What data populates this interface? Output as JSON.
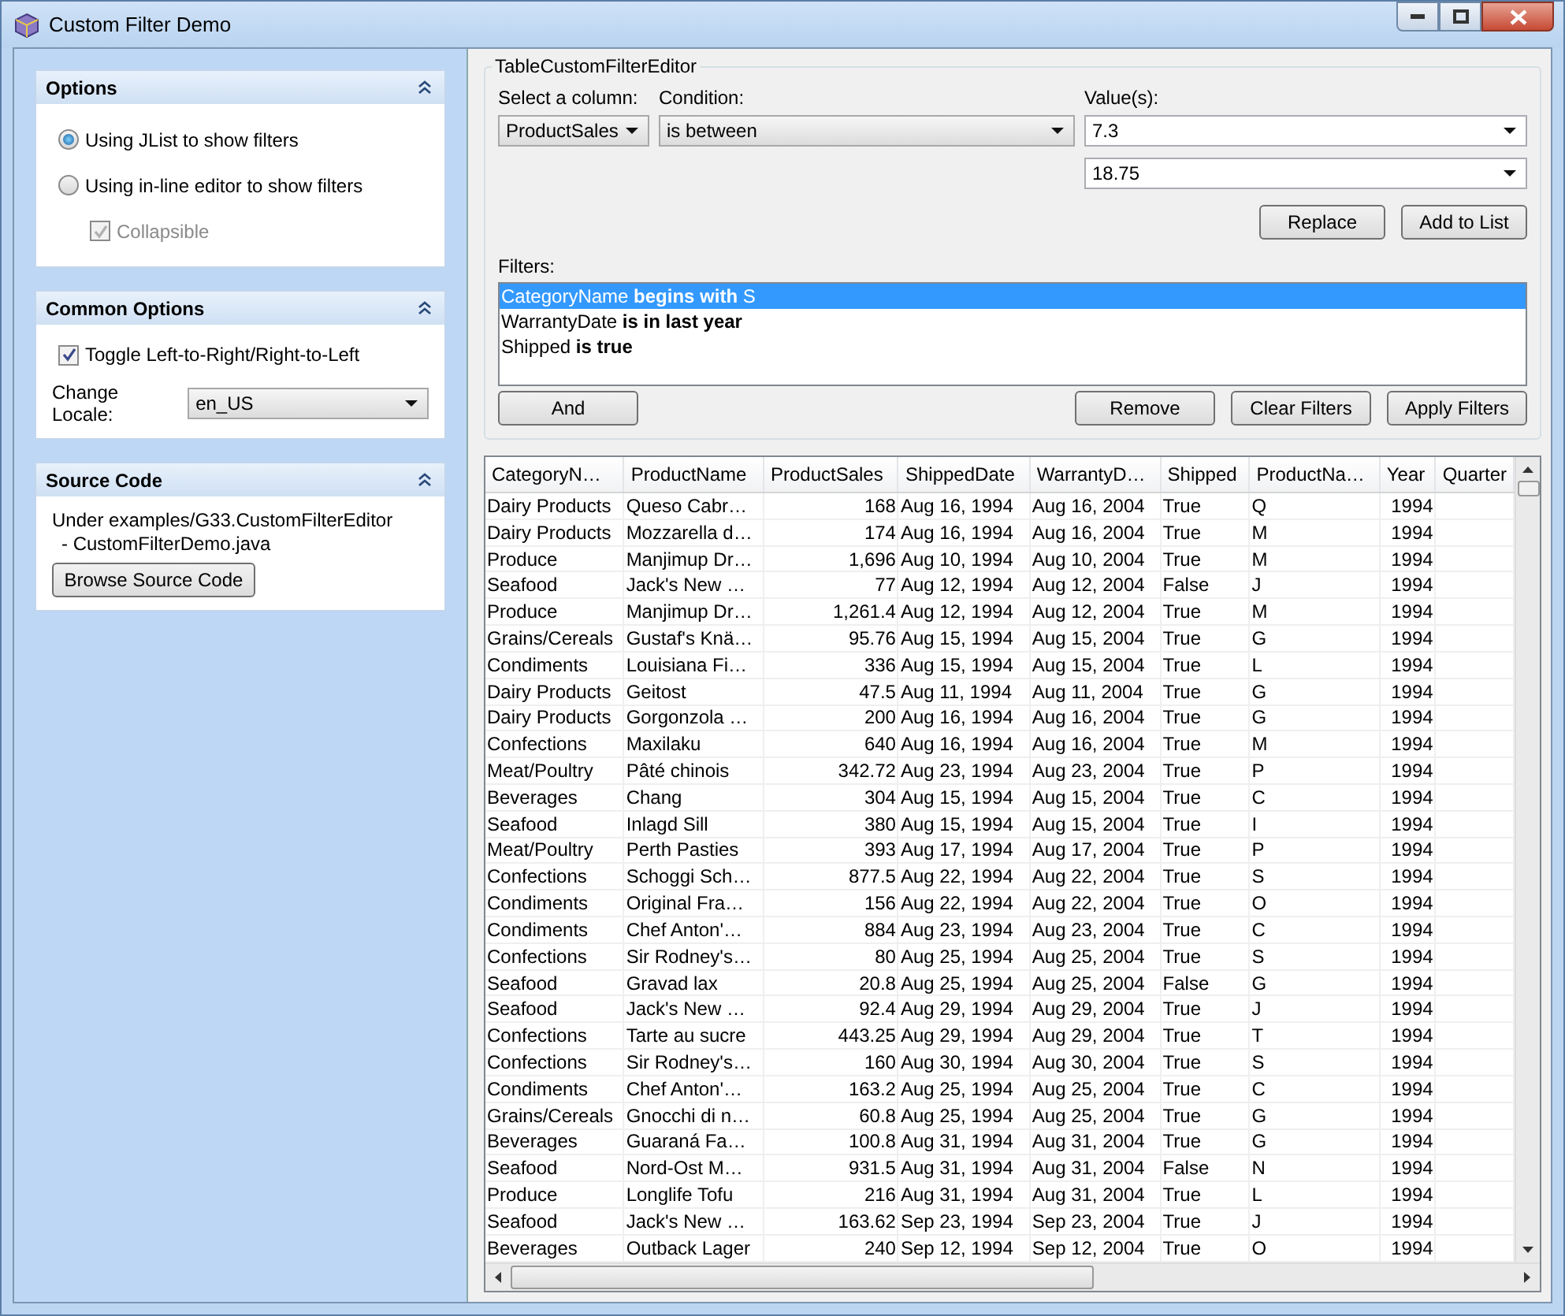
{
  "window": {
    "title": "Custom Filter Demo"
  },
  "sidebar": {
    "panels": [
      {
        "kind": "options",
        "title": "Options",
        "expanded": true,
        "radios": [
          {
            "label": "Using JList to show filters",
            "selected": true
          },
          {
            "label": "Using in-line editor to show filters",
            "selected": false
          }
        ],
        "checkbox": {
          "label": "Collapsible",
          "checked": true,
          "disabled": true
        }
      },
      {
        "kind": "common",
        "title": "Common Options",
        "expanded": true,
        "checkbox": {
          "label": "Toggle Left-to-Right/Right-to-Left",
          "checked": true,
          "disabled": false
        },
        "locale_label": "Change Locale:",
        "locale_value": "en_US"
      },
      {
        "kind": "source",
        "title": "Source Code",
        "expanded": true,
        "lines": [
          "Under examples/G33.CustomFilterEditor",
          "- CustomFilterDemo.java"
        ],
        "button": "Browse Source Code"
      }
    ]
  },
  "editor": {
    "title": "TableCustomFilterEditor",
    "column_label": "Select a column:",
    "column_value": "ProductSales",
    "condition_label": "Condition:",
    "condition_value": "is between",
    "values_label": "Value(s):",
    "values": [
      "7.3",
      "18.75"
    ],
    "top_buttons": [
      "Replace",
      "Add to List"
    ],
    "filters_label": "Filters:",
    "filters": [
      {
        "text": "CategoryName **begins with** S",
        "selected": true
      },
      {
        "text": "WarrantyDate **is in last year**",
        "selected": false
      },
      {
        "text": "Shipped **is true**",
        "selected": false
      }
    ],
    "left_button": "And",
    "bottom_buttons": [
      "Remove",
      "Clear Filters",
      "Apply Filters"
    ]
  },
  "table": {
    "columns": [
      "CategoryN…",
      "ProductName",
      "ProductSales",
      "ShippedDate",
      "WarrantyD…",
      "Shipped",
      "ProductNa…",
      "Year",
      "Quarter"
    ],
    "rows": [
      [
        "Dairy Products",
        "Queso Cabr…",
        "168",
        "Aug 16, 1994",
        "Aug 16, 2004",
        "True",
        "Q",
        "1994"
      ],
      [
        "Dairy Products",
        "Mozzarella d…",
        "174",
        "Aug 16, 1994",
        "Aug 16, 2004",
        "True",
        "M",
        "1994"
      ],
      [
        "Produce",
        "Manjimup Dr…",
        "1,696",
        "Aug 10, 1994",
        "Aug 10, 2004",
        "True",
        "M",
        "1994"
      ],
      [
        "Seafood",
        "Jack's New …",
        "77",
        "Aug 12, 1994",
        "Aug 12, 2004",
        "False",
        "J",
        "1994"
      ],
      [
        "Produce",
        "Manjimup Dr…",
        "1,261.4",
        "Aug 12, 1994",
        "Aug 12, 2004",
        "True",
        "M",
        "1994"
      ],
      [
        "Grains/Cereals",
        "Gustaf's Knä…",
        "95.76",
        "Aug 15, 1994",
        "Aug 15, 2004",
        "True",
        "G",
        "1994"
      ],
      [
        "Condiments",
        "Louisiana Fi…",
        "336",
        "Aug 15, 1994",
        "Aug 15, 2004",
        "True",
        "L",
        "1994"
      ],
      [
        "Dairy Products",
        "Geitost",
        "47.5",
        "Aug 11, 1994",
        "Aug 11, 2004",
        "True",
        "G",
        "1994"
      ],
      [
        "Dairy Products",
        "Gorgonzola …",
        "200",
        "Aug 16, 1994",
        "Aug 16, 2004",
        "True",
        "G",
        "1994"
      ],
      [
        "Confections",
        "Maxilaku",
        "640",
        "Aug 16, 1994",
        "Aug 16, 2004",
        "True",
        "M",
        "1994"
      ],
      [
        "Meat/Poultry",
        "Pâté chinois",
        "342.72",
        "Aug 23, 1994",
        "Aug 23, 2004",
        "True",
        "P",
        "1994"
      ],
      [
        "Beverages",
        "Chang",
        "304",
        "Aug 15, 1994",
        "Aug 15, 2004",
        "True",
        "C",
        "1994"
      ],
      [
        "Seafood",
        "Inlagd Sill",
        "380",
        "Aug 15, 1994",
        "Aug 15, 2004",
        "True",
        "I",
        "1994"
      ],
      [
        "Meat/Poultry",
        "Perth Pasties",
        "393",
        "Aug 17, 1994",
        "Aug 17, 2004",
        "True",
        "P",
        "1994"
      ],
      [
        "Confections",
        "Schoggi Sch…",
        "877.5",
        "Aug 22, 1994",
        "Aug 22, 2004",
        "True",
        "S",
        "1994"
      ],
      [
        "Condiments",
        "Original Fra…",
        "156",
        "Aug 22, 1994",
        "Aug 22, 2004",
        "True",
        "O",
        "1994"
      ],
      [
        "Condiments",
        "Chef Anton'…",
        "884",
        "Aug 23, 1994",
        "Aug 23, 2004",
        "True",
        "C",
        "1994"
      ],
      [
        "Confections",
        "Sir Rodney's…",
        "80",
        "Aug 25, 1994",
        "Aug 25, 2004",
        "True",
        "S",
        "1994"
      ],
      [
        "Seafood",
        "Gravad lax",
        "20.8",
        "Aug 25, 1994",
        "Aug 25, 2004",
        "False",
        "G",
        "1994"
      ],
      [
        "Seafood",
        "Jack's New …",
        "92.4",
        "Aug 29, 1994",
        "Aug 29, 2004",
        "True",
        "J",
        "1994"
      ],
      [
        "Confections",
        "Tarte au sucre",
        "443.25",
        "Aug 29, 1994",
        "Aug 29, 2004",
        "True",
        "T",
        "1994"
      ],
      [
        "Confections",
        "Sir Rodney's…",
        "160",
        "Aug 30, 1994",
        "Aug 30, 2004",
        "True",
        "S",
        "1994"
      ],
      [
        "Condiments",
        "Chef Anton'…",
        "163.2",
        "Aug 25, 1994",
        "Aug 25, 2004",
        "True",
        "C",
        "1994"
      ],
      [
        "Grains/Cereals",
        "Gnocchi di n…",
        "60.8",
        "Aug 25, 1994",
        "Aug 25, 2004",
        "True",
        "G",
        "1994"
      ],
      [
        "Beverages",
        "Guaraná Fa…",
        "100.8",
        "Aug 31, 1994",
        "Aug 31, 2004",
        "True",
        "G",
        "1994"
      ],
      [
        "Seafood",
        "Nord-Ost M…",
        "931.5",
        "Aug 31, 1994",
        "Aug 31, 2004",
        "False",
        "N",
        "1994"
      ],
      [
        "Produce",
        "Longlife Tofu",
        "216",
        "Aug 31, 1994",
        "Aug 31, 2004",
        "True",
        "L",
        "1994"
      ],
      [
        "Seafood",
        "Jack's New …",
        "163.62",
        "Sep 23, 1994",
        "Sep 23, 2004",
        "True",
        "J",
        "1994"
      ],
      [
        "Beverages",
        "Outback Lager",
        "240",
        "Sep 12, 1994",
        "Sep 12, 2004",
        "True",
        "O",
        "1994"
      ]
    ]
  }
}
